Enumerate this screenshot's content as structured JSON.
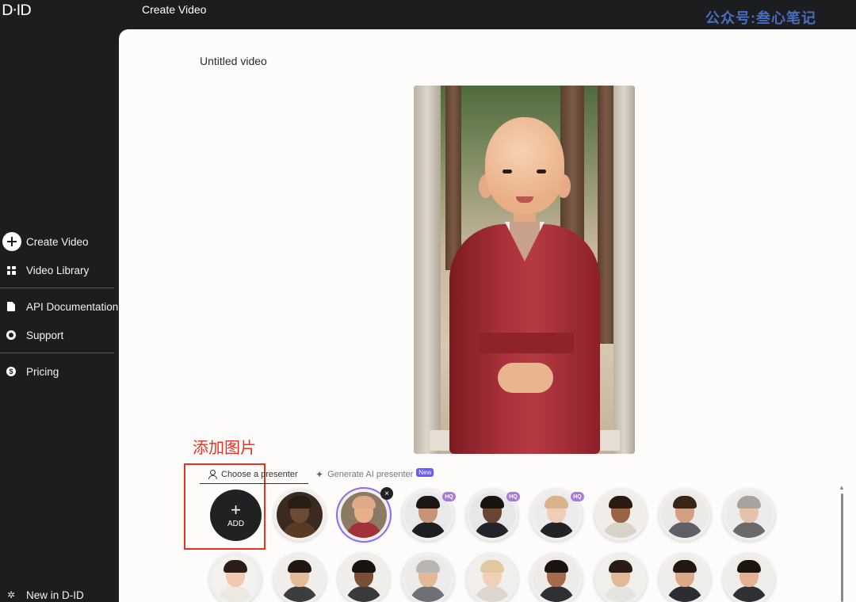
{
  "app": {
    "logo": "D·ID",
    "page_header": "Create Video",
    "watermark": "公众号:叁心笔记"
  },
  "sidebar": {
    "items": [
      {
        "label": "Create Video",
        "icon": "plus-circle-icon"
      },
      {
        "label": "Video Library",
        "icon": "grid-icon"
      },
      {
        "label": "API Documentation",
        "icon": "document-icon"
      },
      {
        "label": "Support",
        "icon": "lifebuoy-icon"
      },
      {
        "label": "Pricing",
        "icon": "dollar-icon"
      }
    ],
    "footer": {
      "label": "New in D-ID",
      "icon": "sparkle-icon"
    }
  },
  "editor": {
    "video_title": "Untitled video",
    "annotation_label": "添加图片"
  },
  "tabs": {
    "choose": "Choose a presenter",
    "generate": "Generate AI presenter",
    "new_badge": "New"
  },
  "presenters": {
    "add_label": "ADD",
    "add_plus": "+",
    "hq_badge": "HQ",
    "close_glyph": "×",
    "items": [
      {
        "desc": "monk-candle",
        "skin": "#6b4a36",
        "hair": "#2a1d15",
        "body": "#5a3a24",
        "bg": "#3b2a1f",
        "hq": false
      },
      {
        "desc": "young-monk",
        "skin": "#e8b08a",
        "hair": "#e0a989",
        "body": "#a2313a",
        "bg": "#8c7a64",
        "hq": false,
        "selected": true
      },
      {
        "desc": "man-black-suit",
        "skin": "#c99476",
        "hair": "#1c1714",
        "body": "#1d1e22",
        "bg": "#e9e9eb",
        "hq": true
      },
      {
        "desc": "man-dark-suit",
        "skin": "#6a4532",
        "hair": "#1a1410",
        "body": "#23242a",
        "bg": "#e7e7e9",
        "hq": true
      },
      {
        "desc": "woman-blazer",
        "skin": "#f0cdb8",
        "hair": "#d7b48a",
        "body": "#222327",
        "bg": "#ececee",
        "hq": true
      },
      {
        "desc": "woman-curly",
        "skin": "#9a6444",
        "hair": "#2a1a12",
        "body": "#d8d2c8",
        "bg": "#f1eee9",
        "hq": false
      },
      {
        "desc": "man-beard",
        "skin": "#d2a080",
        "hair": "#3a2618",
        "body": "#5e6066",
        "bg": "#eceae6",
        "hq": false
      },
      {
        "desc": "woman-gray",
        "skin": "#e6c2ab",
        "hair": "#a8a39d",
        "body": "#6c6a68",
        "bg": "#ecebea",
        "hq": false
      },
      {
        "desc": "woman-smile",
        "skin": "#f0cab0",
        "hair": "#2c1d16",
        "body": "#ece8e2",
        "bg": "#f4f2ef",
        "hq": false
      },
      {
        "desc": "woman-long-hair",
        "skin": "#e6bb98",
        "hair": "#22160f",
        "body": "#3d3d40",
        "bg": "#f0eeeb",
        "hq": false
      },
      {
        "desc": "man-glasses",
        "skin": "#7a4e36",
        "hair": "#1a120d",
        "body": "#3a3a3c",
        "bg": "#f0eeeb",
        "hq": false
      },
      {
        "desc": "man-gray-hair",
        "skin": "#e3b899",
        "hair": "#b9b6b1",
        "body": "#6e7075",
        "bg": "#ecebe9",
        "hq": false
      },
      {
        "desc": "woman-blonde",
        "skin": "#f2cfb8",
        "hair": "#e0c9a0",
        "body": "#dcd6ce",
        "bg": "#f1efec",
        "hq": false
      },
      {
        "desc": "man-smile",
        "skin": "#a46c4c",
        "hair": "#1c130e",
        "body": "#2f3033",
        "bg": "#eeece9",
        "hq": false
      },
      {
        "desc": "man-young",
        "skin": "#e2b897",
        "hair": "#2a1c14",
        "body": "#e6e4e0",
        "bg": "#f1efec",
        "hq": false
      },
      {
        "desc": "man-vest",
        "skin": "#d9a988",
        "hair": "#241810",
        "body": "#2c2d31",
        "bg": "#efedea",
        "hq": false
      },
      {
        "desc": "woman-dark-hair",
        "skin": "#e2b293",
        "hair": "#1e140e",
        "body": "#303034",
        "bg": "#efedea",
        "hq": false
      }
    ]
  },
  "colors": {
    "sidebar_bg": "#1c1d1f",
    "canvas_bg": "#fdfcfb",
    "annotation": "#e8321f",
    "accent": "#6b5cf5",
    "watermark": "#4a6cc0"
  }
}
